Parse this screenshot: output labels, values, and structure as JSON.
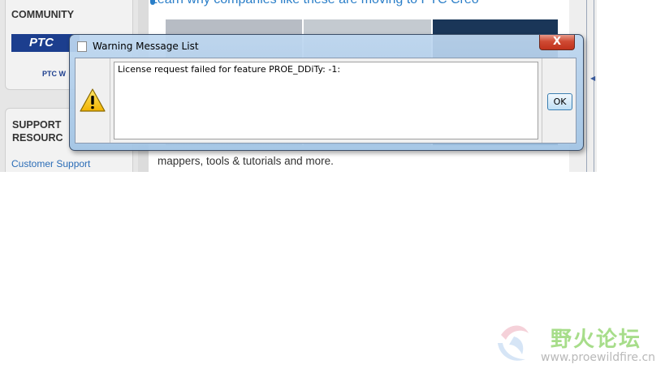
{
  "background_page": {
    "sidebar": {
      "community_heading": "COMMUNITY",
      "ptc_logo_text": "PTC",
      "ptc_sub_logo_text": "PTC W",
      "support_heading": "SUPPORT RESOURC",
      "customer_support_link": "Customer Support"
    },
    "main": {
      "headline": "Learn why companies like these are moving to PTC Creo",
      "body_text": "mappers, tools & tutorials and more."
    }
  },
  "dialog": {
    "title": "Warning Message List",
    "close_label": "X",
    "icon": "warning-triangle-icon",
    "message": "License request failed for feature PROE_DDiTy: -1:",
    "ok_label": "OK"
  },
  "watermark": {
    "name_cn": "野火论坛",
    "url": "www.proewildfire.cn"
  },
  "colors": {
    "dialog_frame": "#b4d0ec",
    "close_button": "#c8432c",
    "link": "#2a6cb6",
    "watermark_green": "#a7dd8a"
  }
}
